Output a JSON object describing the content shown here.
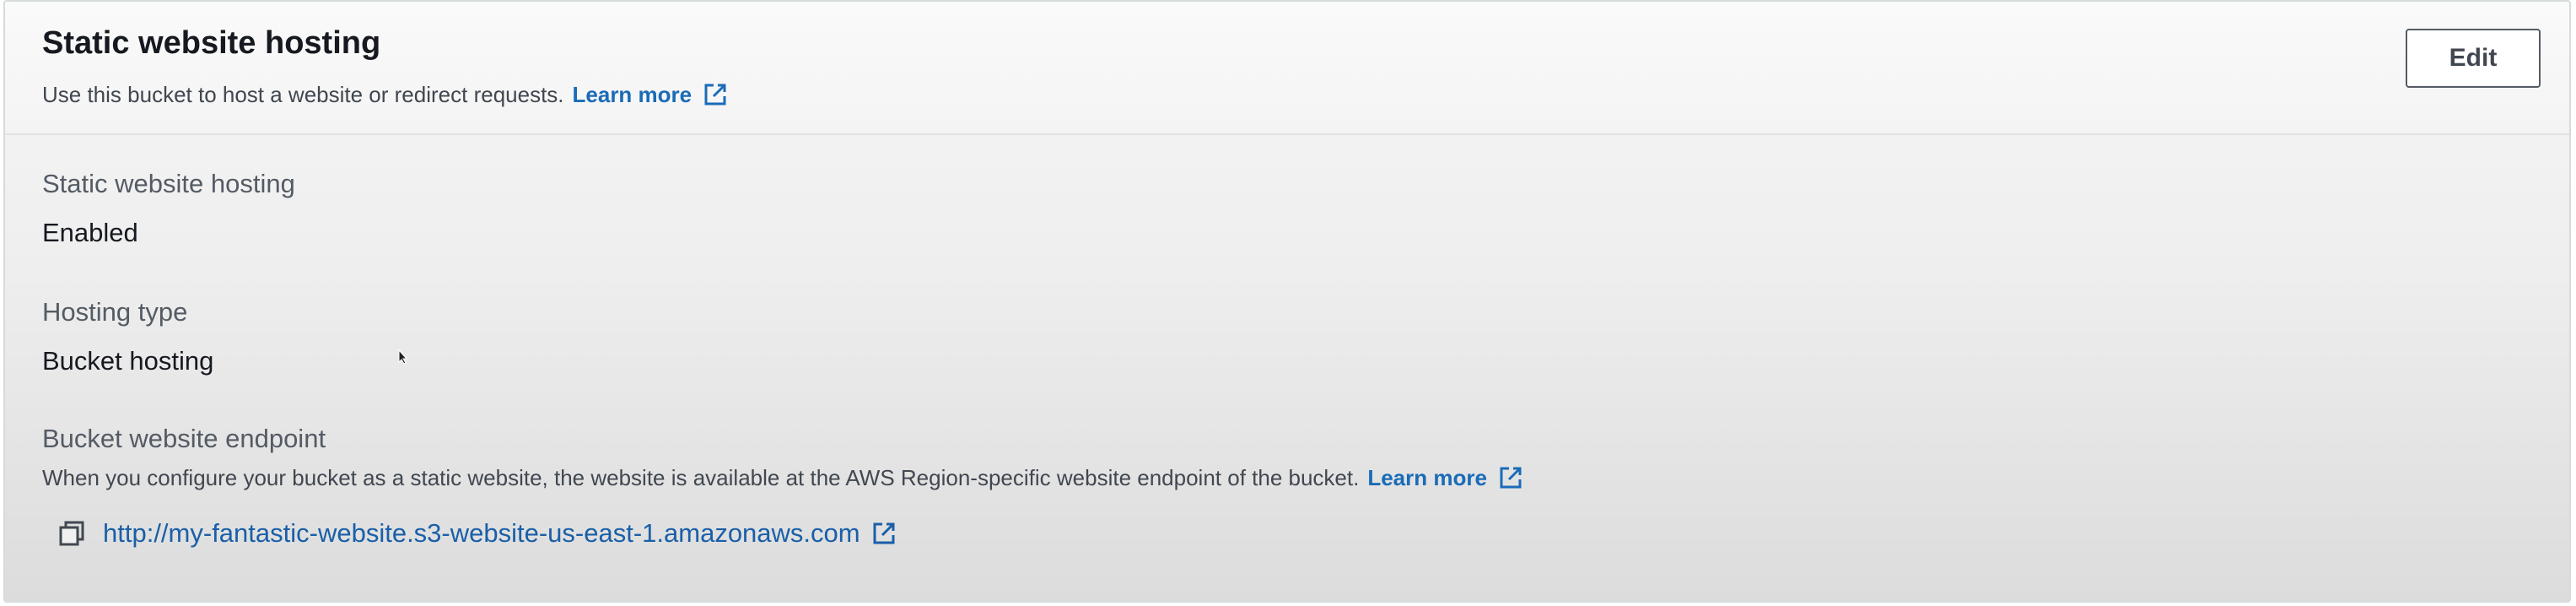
{
  "header": {
    "title": "Static website hosting",
    "description": "Use this bucket to host a website or redirect requests.",
    "learn_more": "Learn more",
    "edit_label": "Edit"
  },
  "fields": {
    "hosting": {
      "label": "Static website hosting",
      "value": "Enabled"
    },
    "hosting_type": {
      "label": "Hosting type",
      "value": "Bucket hosting"
    },
    "endpoint": {
      "label": "Bucket website endpoint",
      "description": "When you configure your bucket as a static website, the website is available at the AWS Region-specific website endpoint of the bucket.",
      "learn_more": "Learn more",
      "url": "http://my-fantastic-website.s3-website-us-east-1.amazonaws.com"
    }
  },
  "icons": {
    "external_link": "external-link-icon",
    "copy": "copy-icon"
  },
  "colors": {
    "link": "#1a6bb8",
    "text": "#16191f",
    "label": "#545b64"
  }
}
